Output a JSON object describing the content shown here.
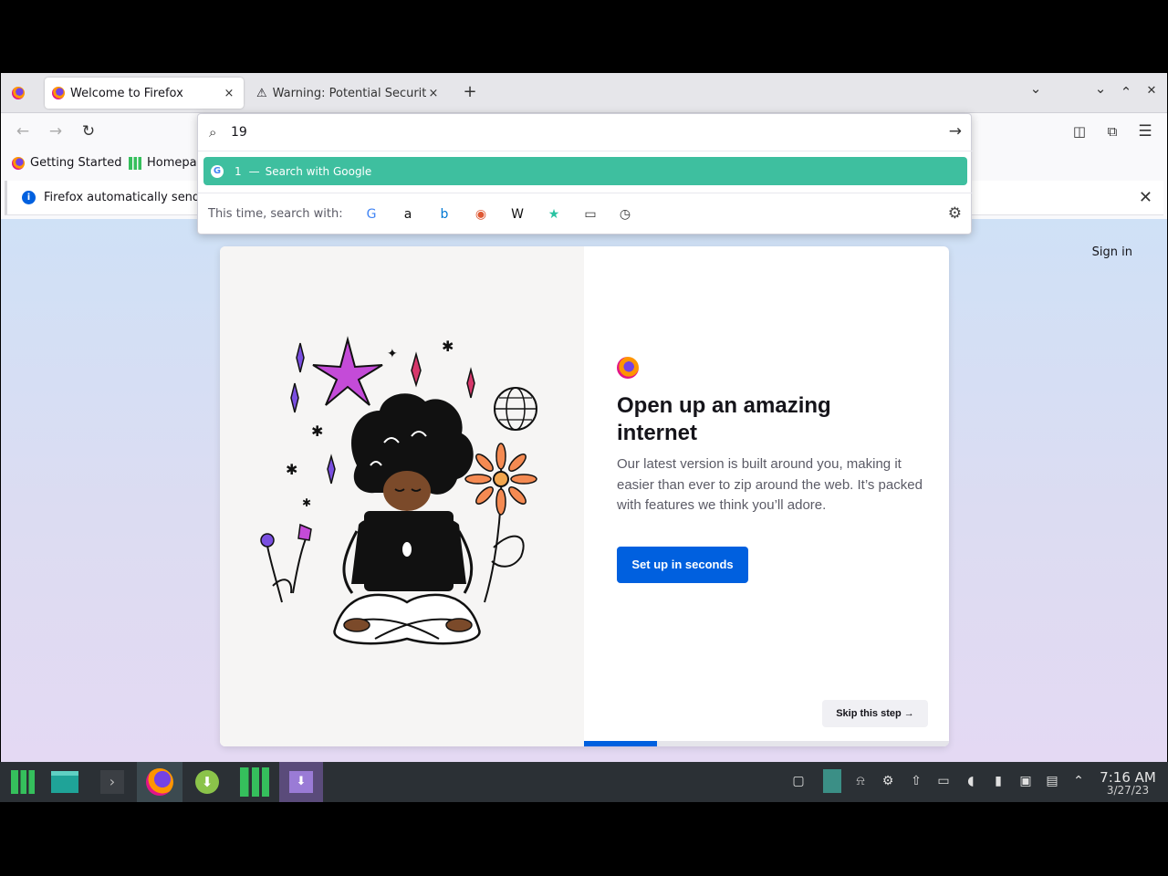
{
  "tabs": [
    {
      "label": "Welcome to Firefox",
      "close": "×"
    },
    {
      "label": "Warning: Potential Security",
      "close": "×"
    }
  ],
  "tabstrip": {
    "new_tab": "+",
    "list_all": "⌄",
    "minimize": "⌄",
    "maximize": "⌃",
    "close": "✕"
  },
  "nav": {
    "back": "←",
    "forward": "→",
    "reload": "↻"
  },
  "urlbar": {
    "value": "19",
    "go": "→",
    "suggestion": {
      "term": "1",
      "dash": "—",
      "action": "Search with Google"
    },
    "oneoff_label": "This time, search with:",
    "engines": [
      {
        "icon": "google-icon",
        "glyph": "G",
        "color": "#4285f4"
      },
      {
        "icon": "amazon-icon",
        "glyph": "a",
        "color": "#111111"
      },
      {
        "icon": "bing-icon",
        "glyph": "b",
        "color": "#0078d4"
      },
      {
        "icon": "duckduckgo-icon",
        "glyph": "◉",
        "color": "#de5833"
      },
      {
        "icon": "wikipedia-icon",
        "glyph": "W",
        "color": "#111111"
      },
      {
        "icon": "bookmarks-star-icon",
        "glyph": "★",
        "color": "#2ac3a2"
      },
      {
        "icon": "tabs-icon",
        "glyph": "▭",
        "color": "#333333"
      },
      {
        "icon": "history-clock-icon",
        "glyph": "◷",
        "color": "#333333"
      }
    ]
  },
  "bookmarks": [
    {
      "label": "Getting Started"
    },
    {
      "label": "Homepa"
    }
  ],
  "notification": {
    "text": "Firefox automatically sends",
    "close": "✕"
  },
  "page": {
    "sign_in": "Sign in",
    "title": "Open up an amazing internet",
    "body": "Our latest version is built around you, making it easier than ever to zip around the web. It’s packed with features we think you’ll adore.",
    "primary_button": "Set up in seconds",
    "skip_button": "Skip this step →",
    "progress": 0.2
  },
  "taskbar": {
    "time": "7:16 AM",
    "date": "3/27/23"
  },
  "colors": {
    "accent": "#0060df",
    "suggestion_highlight": "#3ebf9f",
    "taskbar": "#2b3035",
    "manjaro_green": "#35bf5c"
  }
}
